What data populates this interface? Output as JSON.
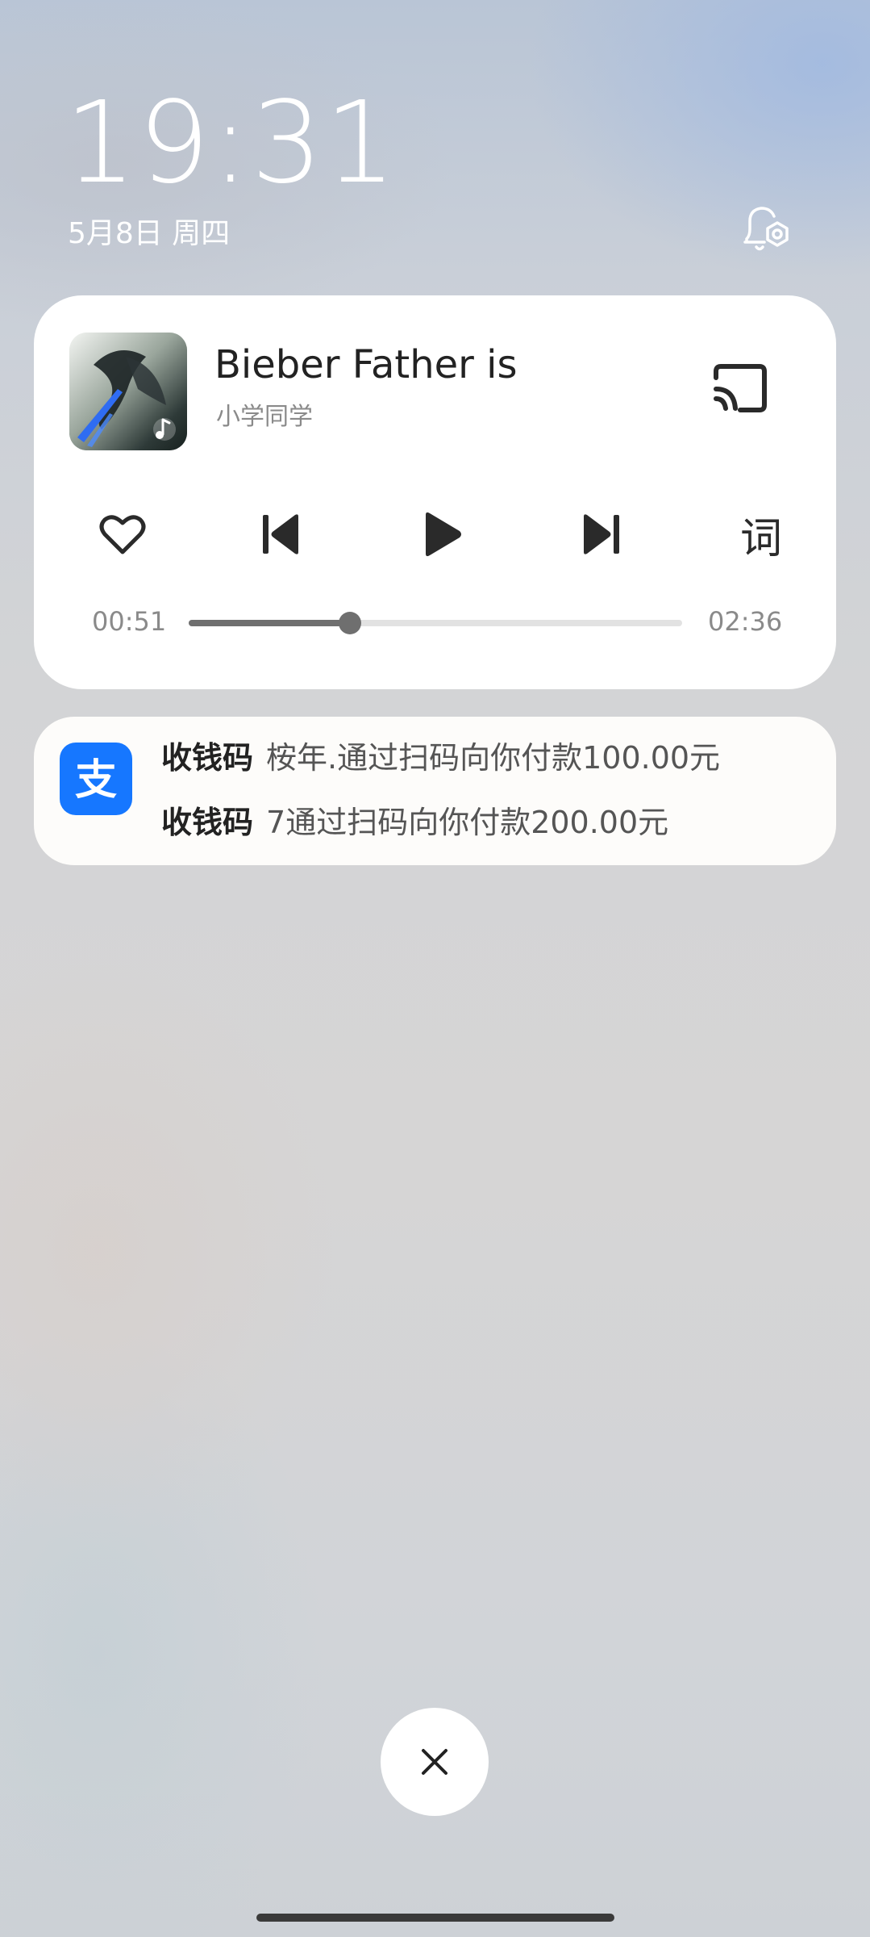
{
  "lockscreen": {
    "time": "19:31",
    "date": "5月8日 周四",
    "bell_settings_icon": "bell-settings-icon"
  },
  "media_player": {
    "album_art_icon": "album-art-image",
    "title": "Bieber Father is",
    "artist": "小学同学",
    "cast_icon": "cast-icon",
    "like_icon": "heart-icon",
    "prev_icon": "skip-previous-icon",
    "play_icon": "play-icon",
    "next_icon": "skip-next-icon",
    "lyrics_label": "词",
    "current_time": "00:51",
    "total_time": "02:36",
    "progress": 0.327
  },
  "notification": {
    "app_icon": "alipay-icon",
    "icon_glyph": "支",
    "accent_color": "#1677ff",
    "items": [
      {
        "title": "收钱码",
        "body": "桉年.通过扫码向你付款100.00元"
      },
      {
        "title": "收钱码",
        "body": "7通过扫码向你付款200.00元"
      }
    ]
  },
  "close_button": {
    "icon": "close-icon"
  }
}
